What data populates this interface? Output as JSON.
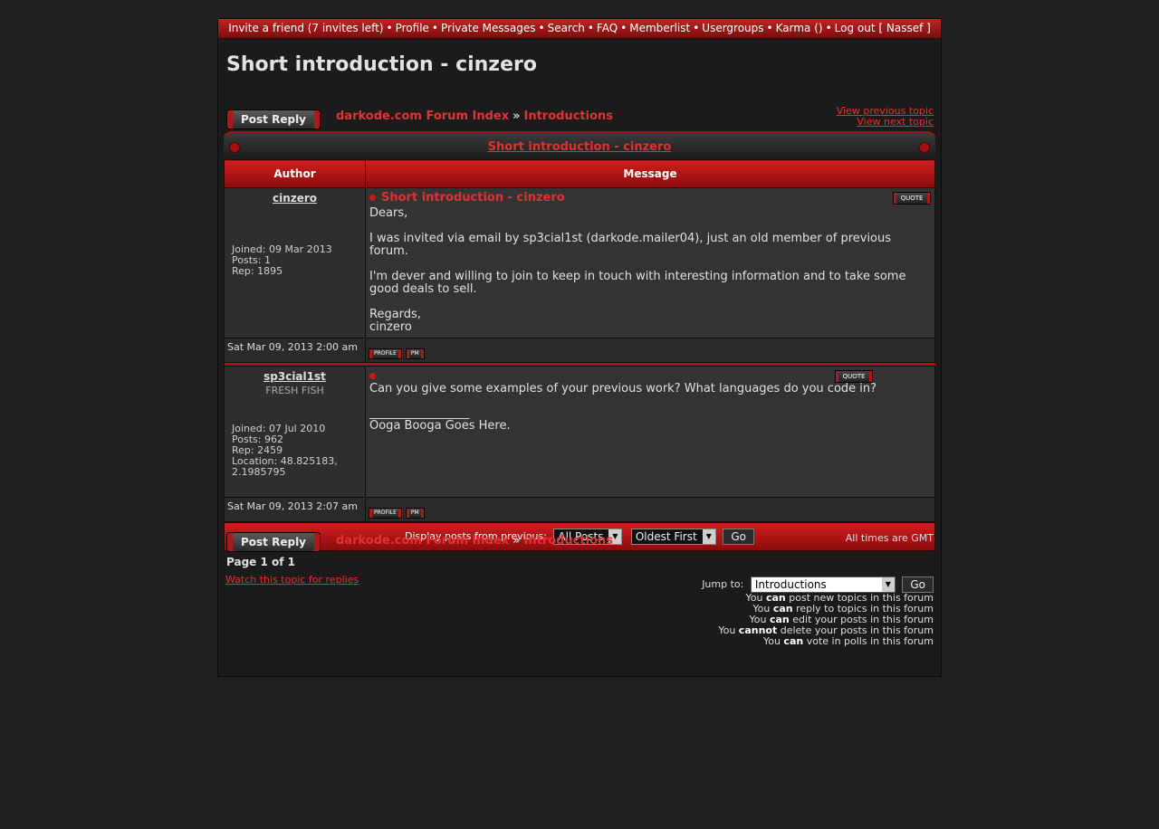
{
  "topnav": {
    "items": [
      "Invite a friend (7 invites left)",
      "Profile",
      "Private Messages",
      "Search",
      "FAQ",
      "Memberlist",
      "Usergroups",
      "Karma ()",
      "Log out [ Nassef ]"
    ],
    "separator": "•"
  },
  "topic": {
    "title": "Short introduction - cinzero"
  },
  "actions": {
    "post_reply": "Post Reply"
  },
  "breadcrumb": {
    "index": "darkode.com Forum Index",
    "sep": "»",
    "forum": "Introductions"
  },
  "topic_nav": {
    "previous": "View previous topic",
    "next": "View next topic"
  },
  "table": {
    "title": "Short introduction - cinzero",
    "col_author": "Author",
    "col_message": "Message"
  },
  "posts": [
    {
      "author": "cinzero",
      "rank": "",
      "joined": "Joined: 09 Mar 2013",
      "posts": "Posts: 1",
      "rep": "Rep: 1895",
      "location": "",
      "subject": "Short introduction - cinzero",
      "body": [
        "Dears,",
        "",
        "I was invited via email by sp3cial1st (darkode.mailer04), just an old member of previous forum.",
        "",
        "I'm dever and willing to join to keep in touch with interesting information and to take some good deals to sell.",
        "",
        "Regards,",
        "cinzero"
      ],
      "date": "Sat Mar 09, 2013 2:00 am",
      "quote": "QUOTE",
      "profile": "PROFILE",
      "pm": "PM"
    },
    {
      "author": "sp3cial1st",
      "rank": "FRESH FISH",
      "joined": "Joined: 07 Jul 2010",
      "posts": "Posts: 962",
      "rep": "Rep: 2459",
      "location": "Location: 48.825183, 2.1985795",
      "subject": "",
      "body": [
        "Can you give some examples of your previous work? What languages do you code in?"
      ],
      "signature_rule": "_________________",
      "signature": "Ooga Booga Goes Here.",
      "date": "Sat Mar 09, 2013 2:07 am",
      "quote": "QUOTE",
      "profile": "PROFILE",
      "pm": "PM"
    }
  ],
  "display": {
    "label": "Display posts from previous:",
    "posts_value": "All Posts",
    "order_value": "Oldest First",
    "go": "Go"
  },
  "footer": {
    "times": "All times are GMT",
    "page": "Page 1 of 1",
    "watch": "Watch this topic for replies",
    "jump_label": "Jump to:",
    "jump_value": "Introductions",
    "jump_go": "Go",
    "perms": [
      {
        "pre": "You ",
        "b": "can",
        "post": " post new topics in this forum"
      },
      {
        "pre": "You ",
        "b": "can",
        "post": " reply to topics in this forum"
      },
      {
        "pre": "You ",
        "b": "can",
        "post": " edit your posts in this forum"
      },
      {
        "pre": "You ",
        "b": "cannot",
        "post": " delete your posts in this forum"
      },
      {
        "pre": "You ",
        "b": "can",
        "post": " vote in polls in this forum"
      }
    ]
  }
}
